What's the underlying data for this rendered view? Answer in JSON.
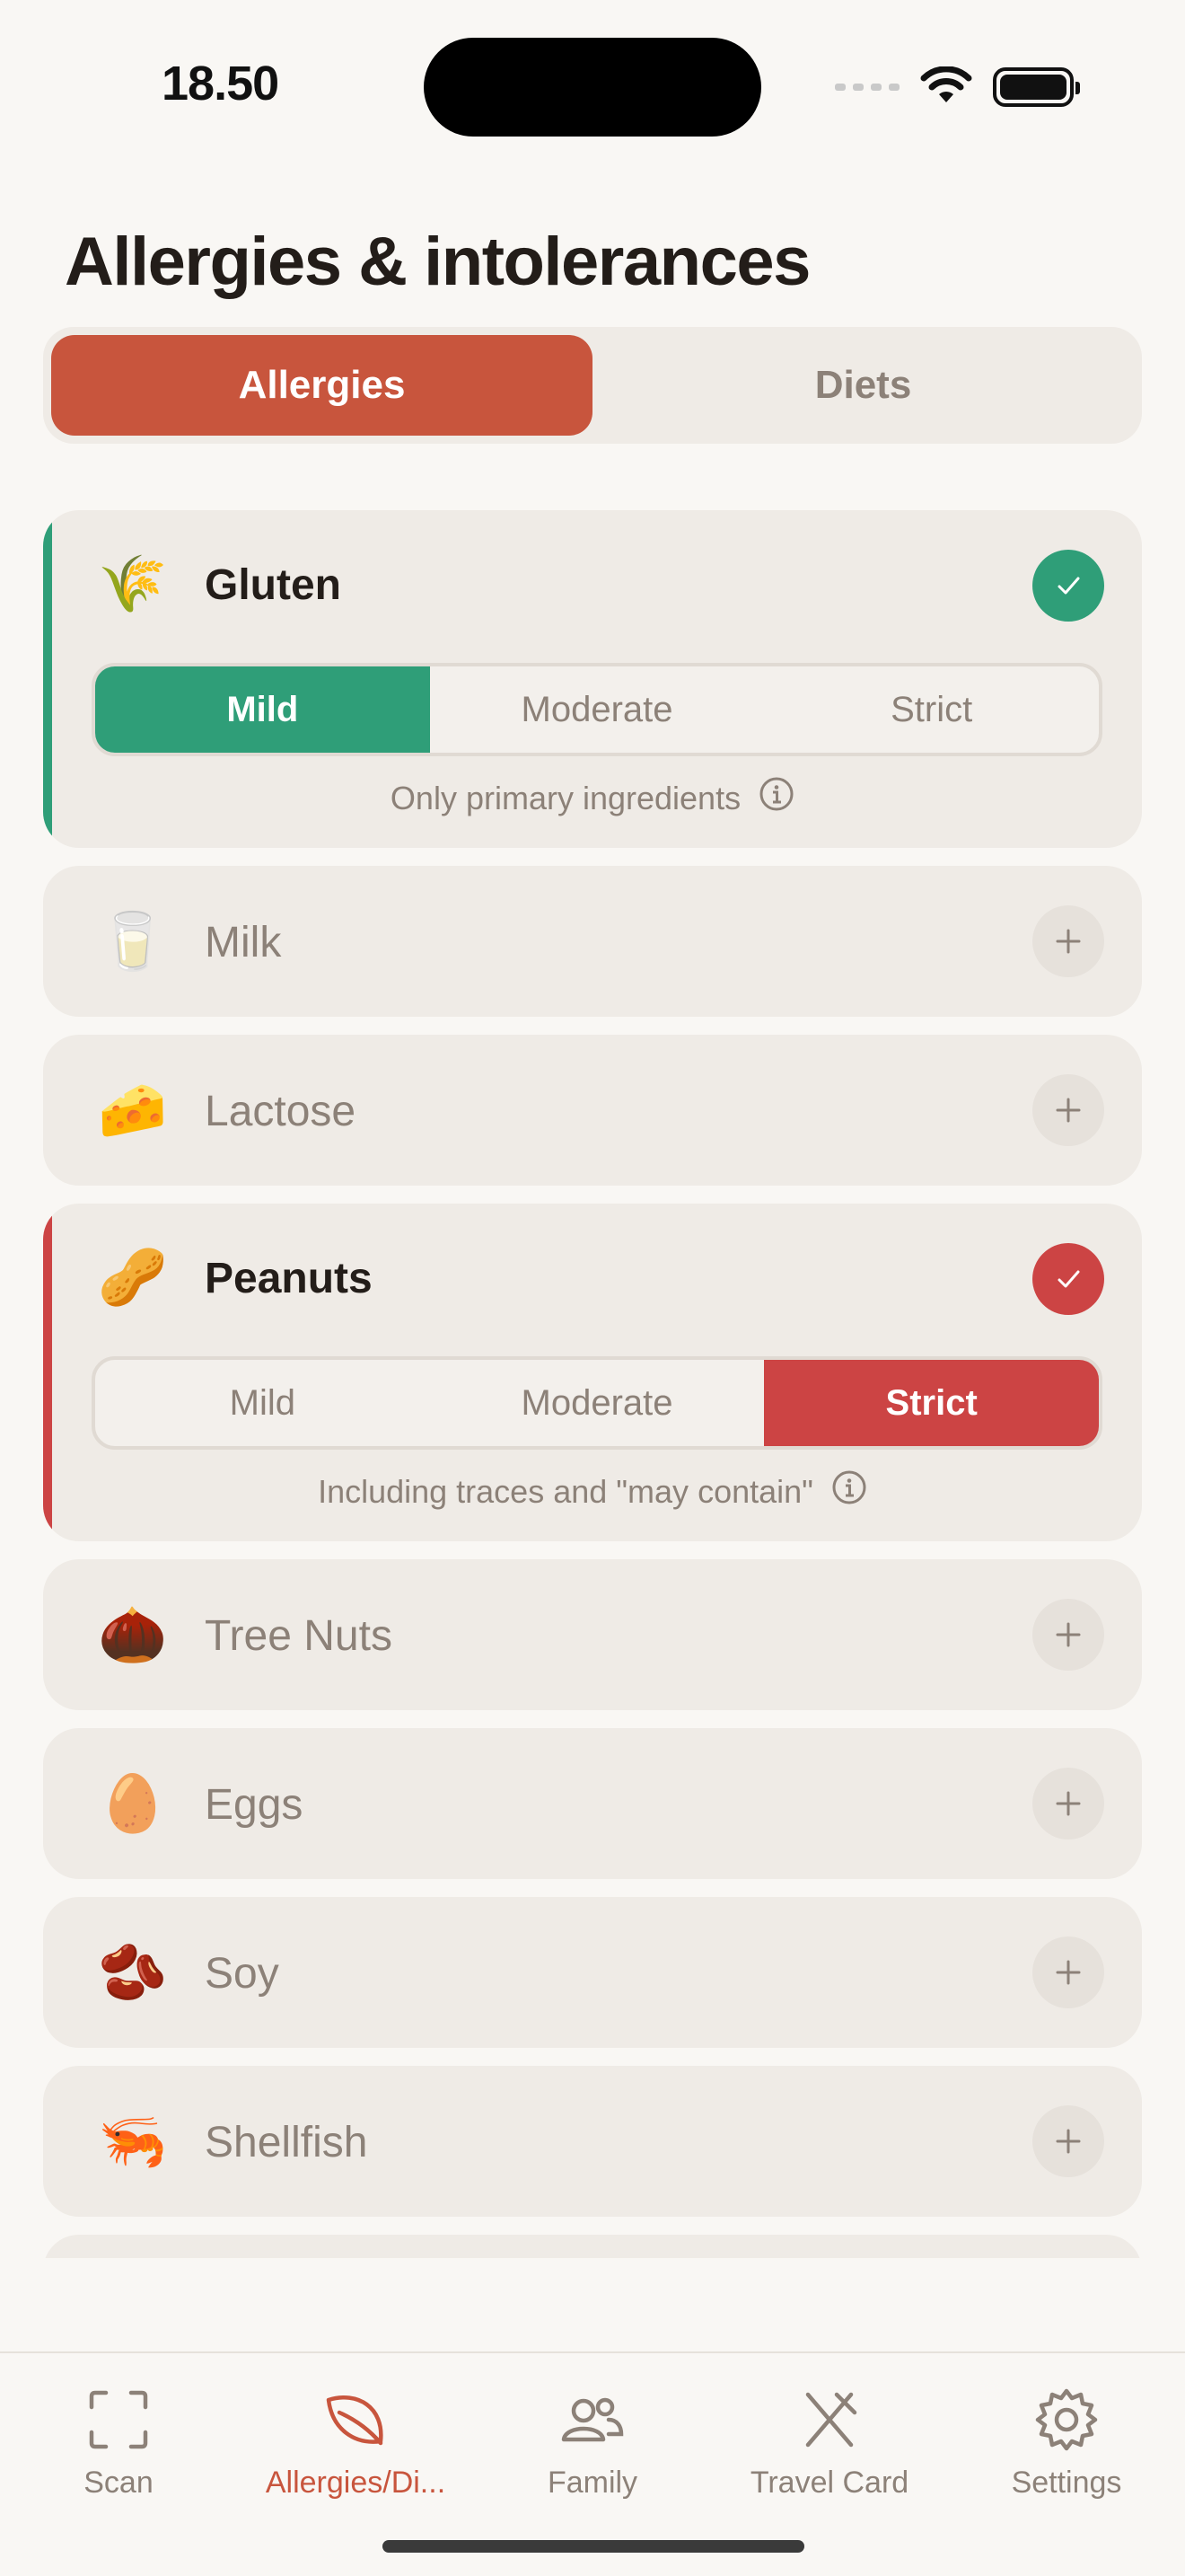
{
  "status_bar": {
    "time": "18.50"
  },
  "page": {
    "title": "Allergies & intolerances"
  },
  "main_tabs": [
    {
      "label": "Allergies",
      "active": true
    },
    {
      "label": "Diets",
      "active": false
    }
  ],
  "severity_labels": [
    "Mild",
    "Moderate",
    "Strict"
  ],
  "allergens": [
    {
      "name": "Gluten",
      "emoji": "🌾",
      "selected": true,
      "severity": "Mild",
      "accent": "#2f9e78",
      "note": "Only primary ingredients"
    },
    {
      "name": "Milk",
      "emoji": "🥛",
      "selected": false
    },
    {
      "name": "Lactose",
      "emoji": "🧀",
      "selected": false
    },
    {
      "name": "Peanuts",
      "emoji": "🥜",
      "selected": true,
      "severity": "Strict",
      "accent": "#cc4444",
      "note": "Including traces and \"may contain\""
    },
    {
      "name": "Tree Nuts",
      "emoji": "🌰",
      "selected": false
    },
    {
      "name": "Eggs",
      "emoji": "🥚",
      "selected": false
    },
    {
      "name": "Soy",
      "emoji": "🫘",
      "selected": false
    },
    {
      "name": "Shellfish",
      "emoji": "🦐",
      "selected": false
    }
  ],
  "tab_bar": [
    {
      "label": "Scan",
      "icon": "scan-icon",
      "active": false
    },
    {
      "label": "Allergies/Di...",
      "icon": "leaf-icon",
      "active": true
    },
    {
      "label": "Family",
      "icon": "family-icon",
      "active": false
    },
    {
      "label": "Travel Card",
      "icon": "utensils-icon",
      "active": false
    },
    {
      "label": "Settings",
      "icon": "gear-icon",
      "active": false
    }
  ],
  "colors": {
    "brand": "#c8553d",
    "mild": "#2f9e78",
    "strict": "#cc4444"
  }
}
